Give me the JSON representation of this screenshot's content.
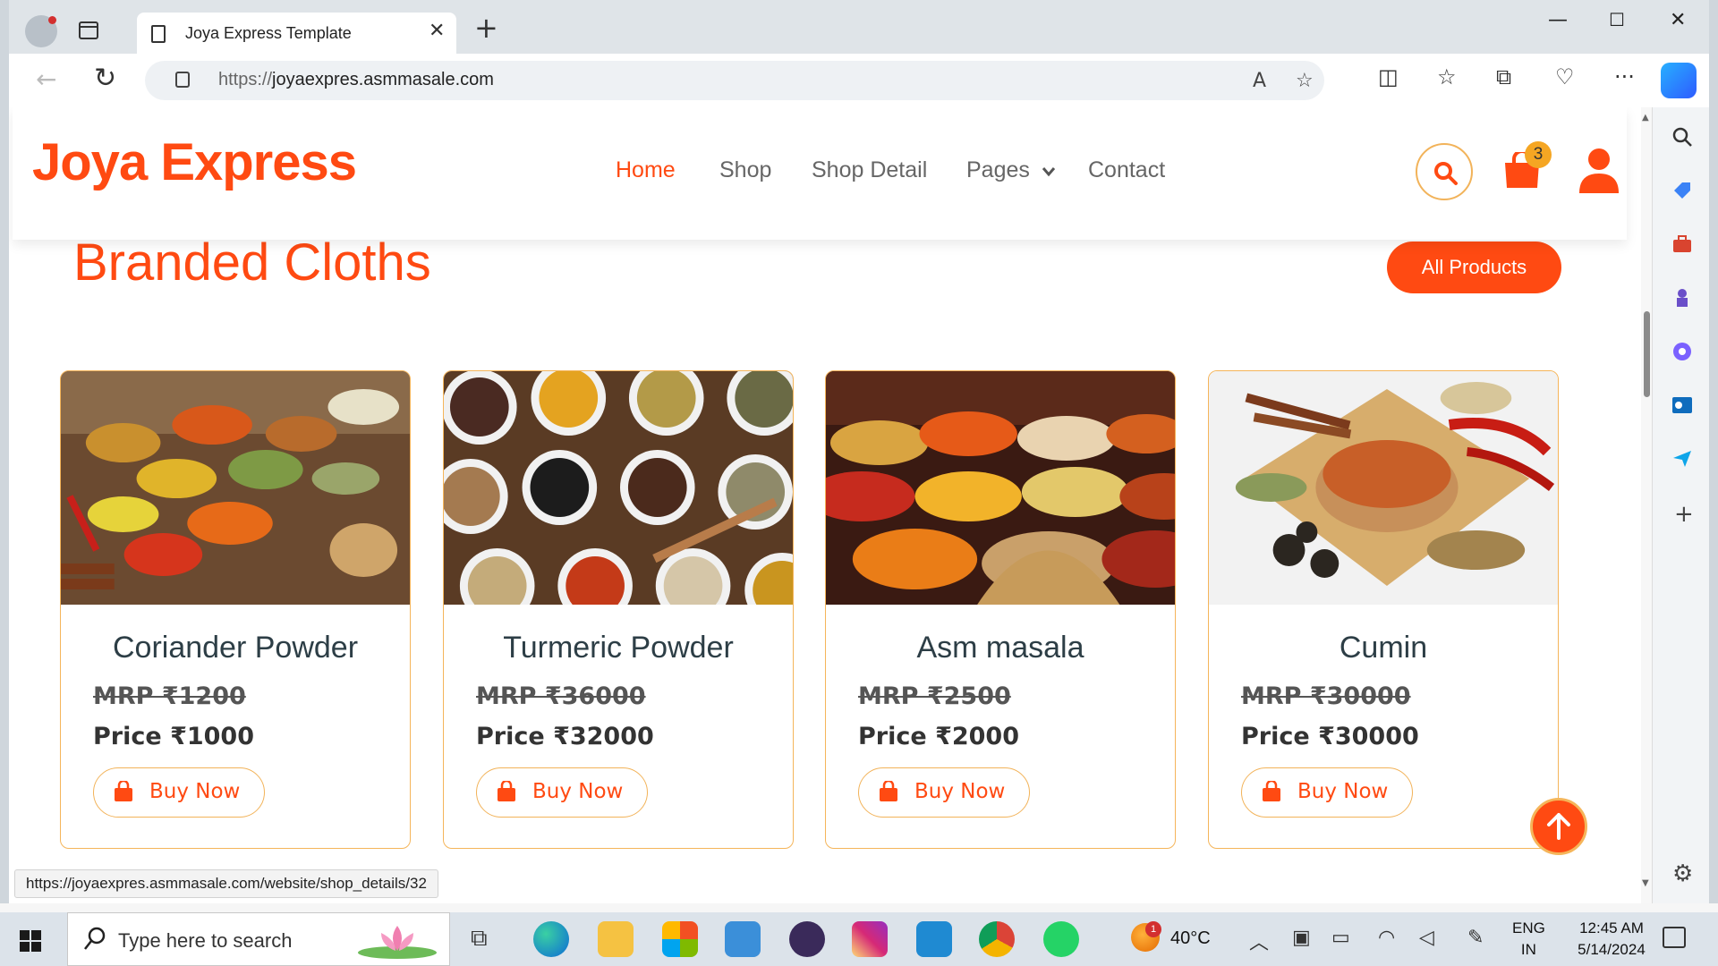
{
  "browser": {
    "tab_title": "Joya Express Template",
    "url_protocol": "https://",
    "url_host": "joyaexpres.asmmasale.com",
    "status_link": "https://joyaexpres.asmmasale.com/website/shop_details/32"
  },
  "site": {
    "brand": "Joya Express",
    "nav": [
      {
        "label": "Home",
        "active": true
      },
      {
        "label": "Shop"
      },
      {
        "label": "Shop Detail"
      },
      {
        "label": "Pages"
      },
      {
        "label": "Contact"
      }
    ],
    "cart_count": "3",
    "accent_color": "#ff4a12",
    "border_color": "#f5b55a"
  },
  "section": {
    "title": "Branded Cloths",
    "all_products_label": "All Products"
  },
  "products": [
    {
      "name": "Coriander Powder",
      "mrp": "MRP ₹1200",
      "price": "Price ₹1000",
      "buy_label": "Buy Now"
    },
    {
      "name": "Turmeric Powder",
      "mrp": "MRP ₹36000",
      "price": "Price ₹32000",
      "buy_label": "Buy Now"
    },
    {
      "name": "Asm masala",
      "mrp": "MRP ₹2500",
      "price": "Price ₹2000",
      "buy_label": "Buy Now"
    },
    {
      "name": "Cumin",
      "mrp": "MRP ₹30000",
      "price": "Price ₹30000",
      "buy_label": "Buy Now"
    }
  ],
  "taskbar": {
    "search_placeholder": "Type here to search",
    "weather_badge": "1",
    "temperature": "40°C",
    "lang_top": "ENG",
    "lang_bottom": "IN",
    "time": "12:45 AM",
    "date": "5/14/2024"
  }
}
